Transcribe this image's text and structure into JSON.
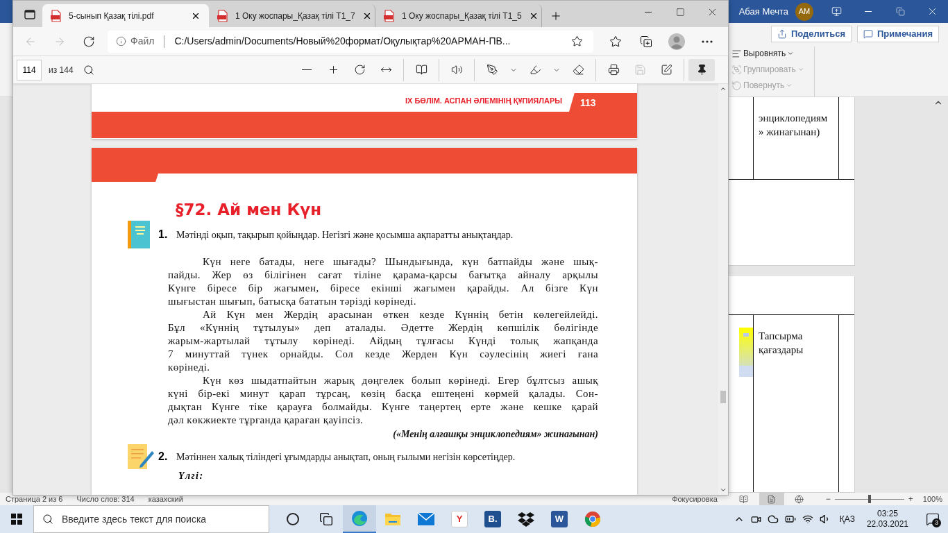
{
  "word": {
    "user": "Абая Мечта",
    "avatar": "AM",
    "ribbon_buttons": [
      {
        "kind": "share",
        "label": "Поделиться"
      },
      {
        "kind": "comments",
        "label": "Примечания"
      }
    ],
    "ribbon_items": [
      {
        "kind": "align",
        "label": "Выровнять",
        "disabled": false
      },
      {
        "kind": "group",
        "label": "Группировать",
        "disabled": true
      },
      {
        "kind": "rotate",
        "label": "Повернуть",
        "disabled": true
      }
    ],
    "pages": [
      {
        "cell": "энциклопедиям » жинағынан)",
        "picture": false
      },
      {
        "cell": "Тапсырма қағаздары",
        "picture": true
      }
    ],
    "status_bar": {
      "left": [
        "Страница 2 из 6",
        "Число слов: 314",
        "казахский"
      ],
      "focus": "Фокусировка",
      "views": [
        {
          "kind": "read",
          "selected": false
        },
        {
          "kind": "print",
          "selected": true
        },
        {
          "kind": "web",
          "selected": false
        }
      ],
      "zoom": {
        "level": 0.5,
        "minus": "−",
        "plus": "+",
        "reading": "100%"
      }
    }
  },
  "browser": {
    "tabs": [
      {
        "title": "5-сынып Қазақ тілі.pdf",
        "selected": true
      },
      {
        "title": "1 Оку жоспары_Қазақ тілі T1_7",
        "selected": false
      },
      {
        "title": "1 Оку жоспары_Қазақ тілі T1_5",
        "selected": false
      }
    ],
    "nav": [
      {
        "kind": "back",
        "disabled": true
      },
      {
        "kind": "forward",
        "disabled": true
      },
      {
        "kind": "refresh",
        "disabled": false
      }
    ],
    "address": {
      "scheme": "Файл",
      "url": "C:/Users/admin/Documents/Новый%20формат/Оқулықтар%20АРМАН-ПВ..."
    },
    "pdf_toolbar": {
      "page": "114",
      "page_count": "из 144",
      "groups": [
        [
          {
            "kind": "zoom_out",
            "disabled": false,
            "selected": false
          },
          {
            "kind": "zoom_in",
            "disabled": false,
            "selected": false
          },
          {
            "kind": "rotate",
            "disabled": false,
            "selected": false
          },
          {
            "kind": "fit",
            "disabled": false,
            "selected": false
          }
        ],
        [
          {
            "kind": "page_view",
            "disabled": false,
            "selected": false
          }
        ],
        [
          {
            "kind": "read_aloud",
            "disabled": false,
            "selected": false
          }
        ],
        [
          {
            "kind": "draw",
            "disabled": false,
            "selected": false
          },
          {
            "kind": "caret",
            "disabled": false,
            "selected": false
          },
          {
            "kind": "highlight",
            "disabled": false,
            "selected": false
          },
          {
            "kind": "caret",
            "disabled": false,
            "selected": false
          },
          {
            "kind": "erase",
            "disabled": false,
            "selected": false
          }
        ],
        [
          {
            "kind": "print",
            "disabled": false,
            "selected": false
          },
          {
            "kind": "save",
            "disabled": true,
            "selected": false
          },
          {
            "kind": "save_as",
            "disabled": false,
            "selected": false
          }
        ],
        [
          {
            "kind": "pin",
            "disabled": false,
            "selected": true
          }
        ]
      ]
    },
    "pages": {
      "header": "IX БӨЛІМ. АСПАН ӘЛЕМІНІҢ ҚҰПИЯЛАРЫ",
      "number": "113",
      "title": "§72. Ай мен Күн",
      "tasks": [
        {
          "kind": "reading",
          "number": "1.",
          "instruction": "Мәтінді оқып, тақырып қойыңдар. Негізгі және қосымша ақпаратты анықтаңдар.",
          "paragraphs": [
            [
              "Күн неге батады, неге шығады? Шындығында, күн батпайды және шық-",
              "пайды. Жер өз білігінен сағат тіліне қарама-қарсы бағытқа айналу арқылы",
              "Күнге біресе бір жағымен, біресе екінші жағымен қарайды. Ал бізге Күн",
              "шығыстан шығып, батысқа бататын тәрізді көрінеді."
            ],
            [
              "Ай Күн мен Жердің арасынан өткен кезде Күннің бетін көлегейлейді.",
              "Бұл «Күннің тұтылуы» деп аталады. Әдетте Жердің көпшілік бөлігінде",
              "жарым-жартылай тұтылу көрінеді. Айдың тұлғасы Күнді толық жапқанда",
              "7 минуттай түнек орнайды. Сол кезде Жерден Күн сәулесінің жиегі ғана",
              "көрінеді."
            ],
            [
              "Күн көз шыдатпайтын жарық дөңгелек болып көрінеді. Егер бұлтсыз ашық",
              "күні бір-екі минут қарап тұрсаң, көзің басқа ештеңені көрмей қалады. Сон-",
              "дықтан Күнге тіке қарауға болмайды. Күнге таңертең ерте және кешке қарай",
              "дәл көкжиекте тұрғанда қараған қауіпсіз."
            ]
          ],
          "source": "(«Менің алғашқы энциклопедиям» жинағынан)"
        },
        {
          "kind": "writing",
          "number": "2.",
          "instruction": "Мәтіннен халық тіліндегі ұғымдарды анықтап, оның ғылыми негізін көрсетіңдер.",
          "sample": "Үлгі:"
        }
      ]
    }
  },
  "taskbar": {
    "search_placeholder": "Введите здесь текст для поиска",
    "apps": [
      {
        "kind": "cortana",
        "active": false
      },
      {
        "kind": "taskview",
        "active": false
      },
      {
        "kind": "edge",
        "active": true
      },
      {
        "kind": "explorer",
        "active": false
      },
      {
        "kind": "mail",
        "active": false
      },
      {
        "kind": "yandex",
        "glyph": "Y",
        "active": false
      },
      {
        "kind": "bitrix",
        "glyph": "B.",
        "active": false
      },
      {
        "kind": "dropbox",
        "active": false
      },
      {
        "kind": "word",
        "glyph": "W",
        "active": false
      },
      {
        "kind": "chrome",
        "active": false
      }
    ],
    "language": "ҚАЗ",
    "time": "03:25",
    "date": "22.03.2021",
    "notifications": "3"
  }
}
